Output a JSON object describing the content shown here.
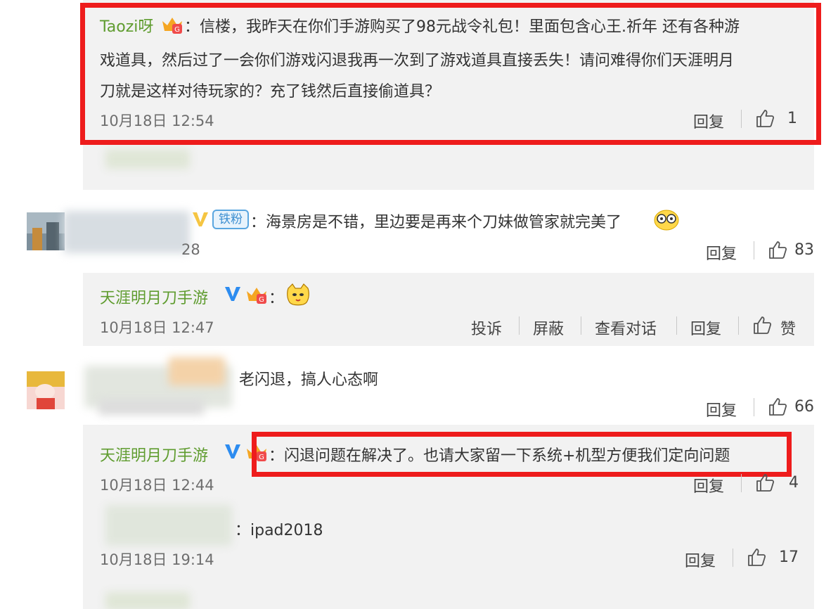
{
  "comment1": {
    "username": "Taozi呀",
    "line1": "：信楼，我昨天在你们手游购买了98元战令礼包！里面包含心王.祈年 还有各种游",
    "line2": "戏道具，然后过了一会你们游戏闪退我再一次到了游戏道具直接丢失！请问难得你们天涯明月",
    "line3": "刀就是这样对待玩家的？充了钱然后直接偷道具？",
    "time": "10月18日 12:54",
    "reply": "回复",
    "likes": "1"
  },
  "comment2": {
    "badge": "铁粉",
    "text": "：海景房是不错，里边要是再来个刀妹做管家就完美了",
    "time_partial": "28",
    "reply": "回复",
    "likes": "83",
    "sub": {
      "username": "天涯明月刀手游",
      "colon": "：",
      "time": "10月18日 12:47",
      "report": "投诉",
      "block": "屏蔽",
      "view_conversation": "查看对话",
      "reply": "回复",
      "like": "赞"
    }
  },
  "comment3": {
    "text": "老闪退，搞人心态啊",
    "reply": "回复",
    "likes": "66",
    "sub1": {
      "username": "天涯明月刀手游",
      "text": "：闪退问题在解决了。也请大家留一下系统+机型方便我们定向问题",
      "time": "10月18日 12:44",
      "reply": "回复",
      "likes": "4"
    },
    "sub2": {
      "text": "：ipad2018",
      "time": "10月18日 19:14",
      "reply": "回复",
      "likes": "17"
    }
  },
  "colors": {
    "highlight_red": "#ee1c1c",
    "username_green": "#5f9c2f",
    "reply_bg": "#f2f2f2",
    "badge_blue": "#5aa6e0",
    "verified_blue": "#2d8cf0"
  }
}
